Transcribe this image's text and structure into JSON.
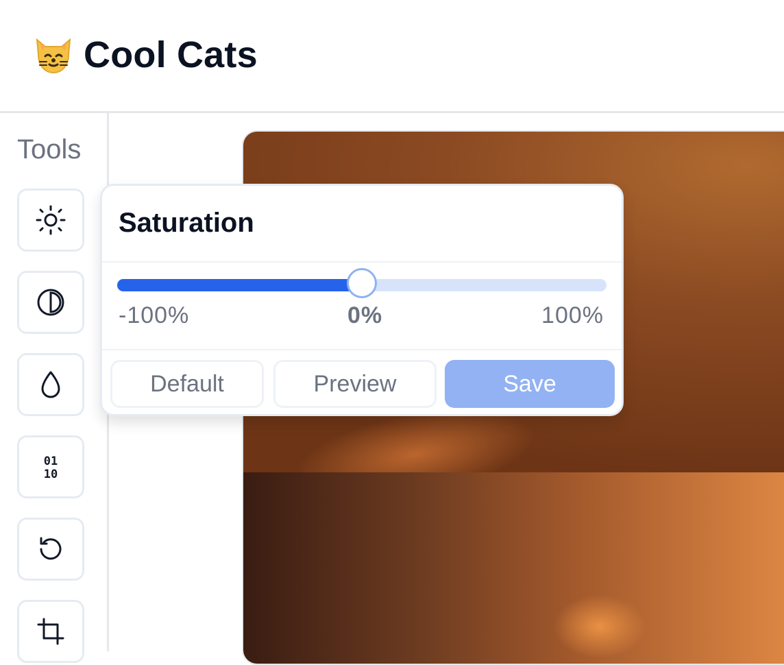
{
  "header": {
    "title": "Cool Cats",
    "logo_icon": "cat-face-icon"
  },
  "sidebar": {
    "label": "Tools",
    "tools": [
      {
        "name": "brightness",
        "icon": "sun-icon"
      },
      {
        "name": "contrast",
        "icon": "contrast-icon"
      },
      {
        "name": "saturation",
        "icon": "droplet-icon"
      },
      {
        "name": "binary",
        "icon": "binary-icon",
        "glyph_top": "01",
        "glyph_bottom": "10"
      },
      {
        "name": "rotate",
        "icon": "rotate-ccw-icon"
      },
      {
        "name": "crop",
        "icon": "crop-icon"
      }
    ]
  },
  "popover": {
    "title": "Saturation",
    "slider": {
      "min_label": "-100%",
      "current_label": "0%",
      "max_label": "100%",
      "value": 0.5
    },
    "buttons": {
      "default": "Default",
      "preview": "Preview",
      "save": "Save"
    }
  },
  "colors": {
    "accent": "#2563eb",
    "track": "#d6e3fb",
    "save": "#92b2f3",
    "text_muted": "#6b7280"
  }
}
